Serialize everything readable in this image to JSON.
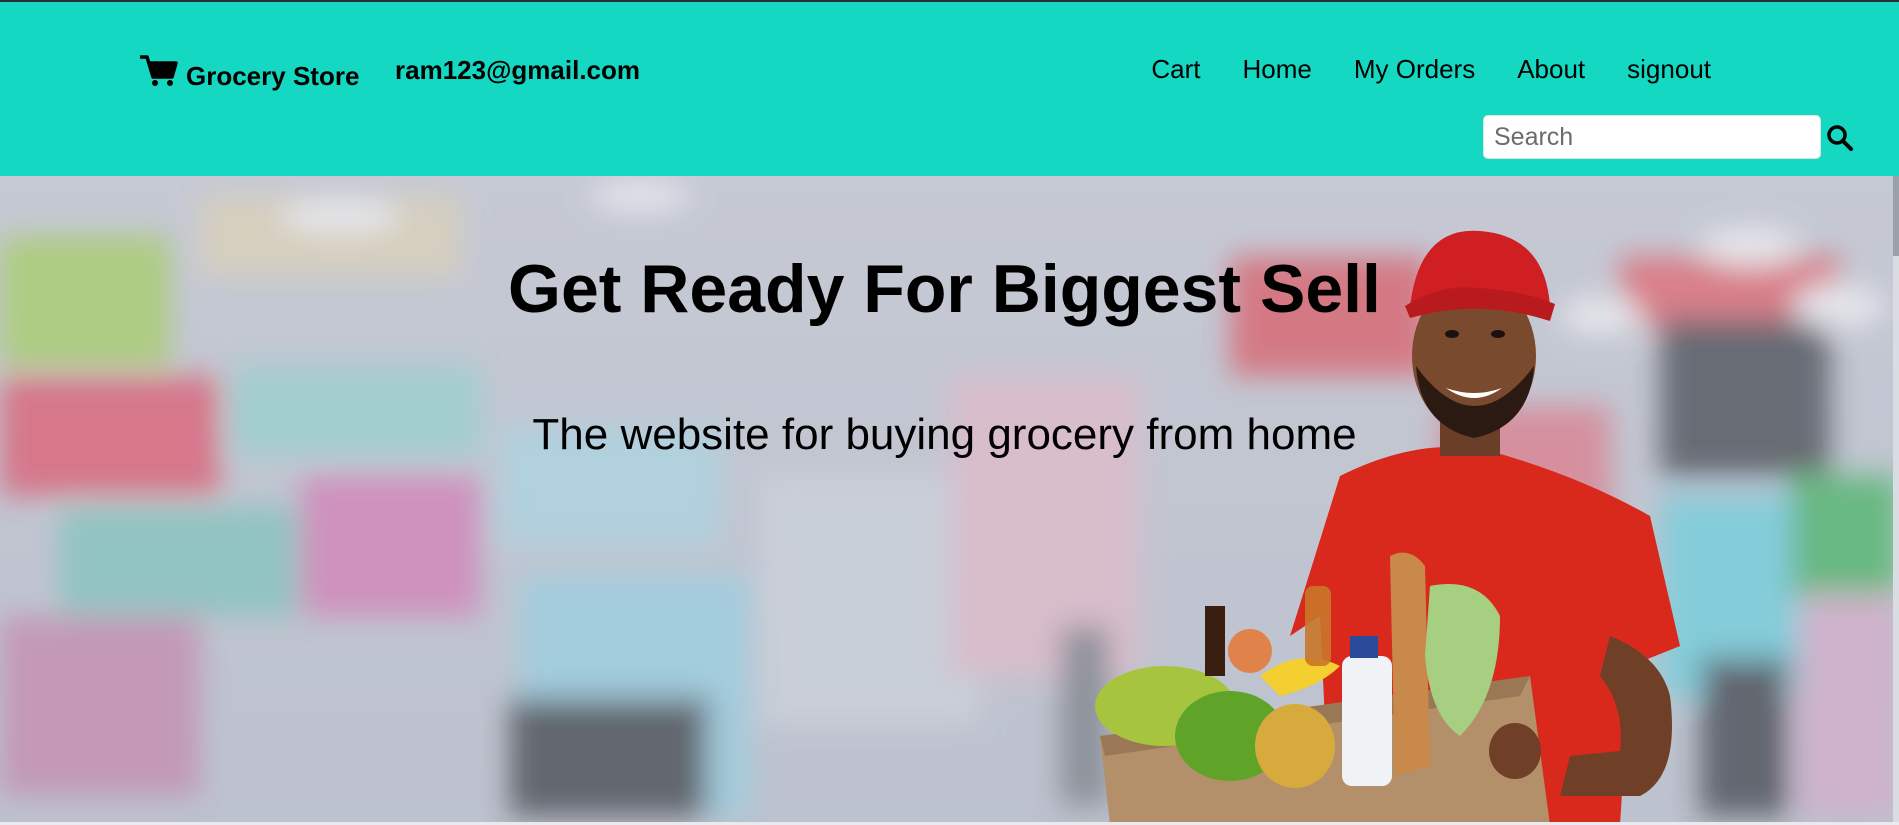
{
  "brand": {
    "name": "Grocery Store",
    "icon": "shopping-cart-icon"
  },
  "user": {
    "email": "ram123@gmail.com"
  },
  "nav": {
    "items": [
      {
        "label": "Cart"
      },
      {
        "label": "Home"
      },
      {
        "label": "My Orders"
      },
      {
        "label": "About"
      },
      {
        "label": "signout"
      }
    ]
  },
  "search": {
    "placeholder": "Search",
    "value": "",
    "icon": "search-icon"
  },
  "hero": {
    "title": "Get Ready For Biggest Sell",
    "subtitle": "The website for buying grocery from home",
    "image": "grocery-delivery-man-with-produce-box"
  },
  "colors": {
    "navbar_bg": "#14d8c1",
    "text": "#000000",
    "hero_shirt": "#d9281c"
  }
}
